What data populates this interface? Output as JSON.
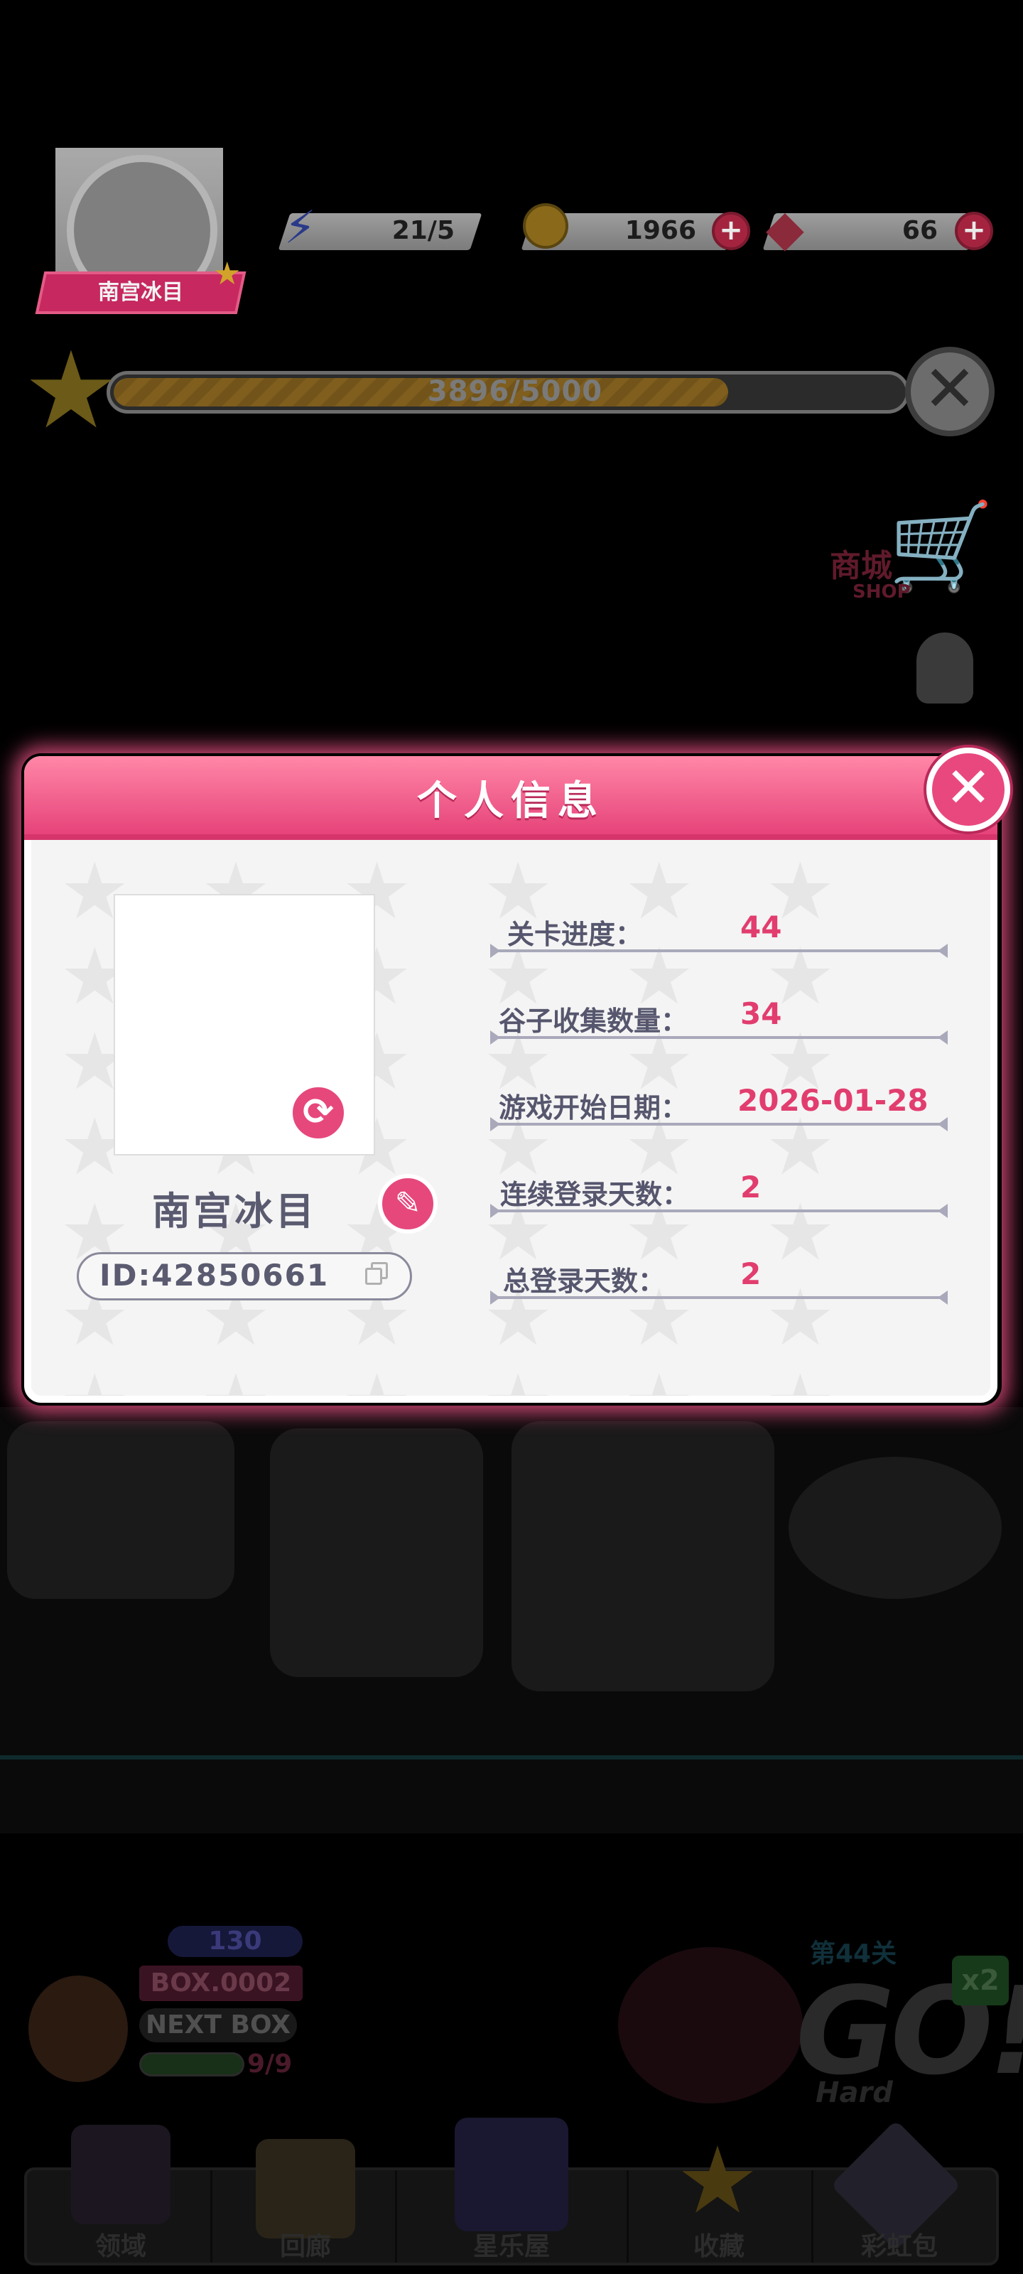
{
  "hud": {
    "player_name": "南宫冰目",
    "energy": "21/5",
    "coins": "1966",
    "gems": "66",
    "plus_symbol": "+",
    "exp_text": "3896/5000",
    "exp_progress": 0.7792,
    "shop_cn": "商城",
    "shop_en": "SHOP"
  },
  "dialog": {
    "title": "个人信息",
    "close_symbol": "✕",
    "name": "南宫冰目",
    "id_text": "ID:42850661",
    "rows": [
      {
        "label": "关卡进度：",
        "value": "44"
      },
      {
        "label": "谷子收集数量：",
        "value": "34"
      },
      {
        "label": "游戏开始日期：",
        "value": "2026-01-28"
      },
      {
        "label": "连续登录天数：",
        "value": "2"
      },
      {
        "label": "总登录天数：",
        "value": "2"
      }
    ]
  },
  "scene": {
    "level_badge": "130",
    "box_label": "BOX.0002",
    "next_box": "NEXT BOX",
    "box_count": "9/9",
    "stage_label": "第44关",
    "go_text": "GO!",
    "difficulty": "Hard",
    "multiplier": "x2"
  },
  "nav": {
    "items": [
      {
        "label": "领域",
        "icon": "domain-icon"
      },
      {
        "label": "回廊",
        "icon": "gallery-icon"
      },
      {
        "label": "星乐屋",
        "icon": "star-house-icon"
      },
      {
        "label": "收藏",
        "icon": "collection-star-icon"
      },
      {
        "label": "彩虹包",
        "icon": "rainbow-pack-icon"
      }
    ]
  },
  "colors": {
    "accent_pink": "#e6437a",
    "value_pink": "#e23d6f",
    "label_gray": "#56566e"
  }
}
